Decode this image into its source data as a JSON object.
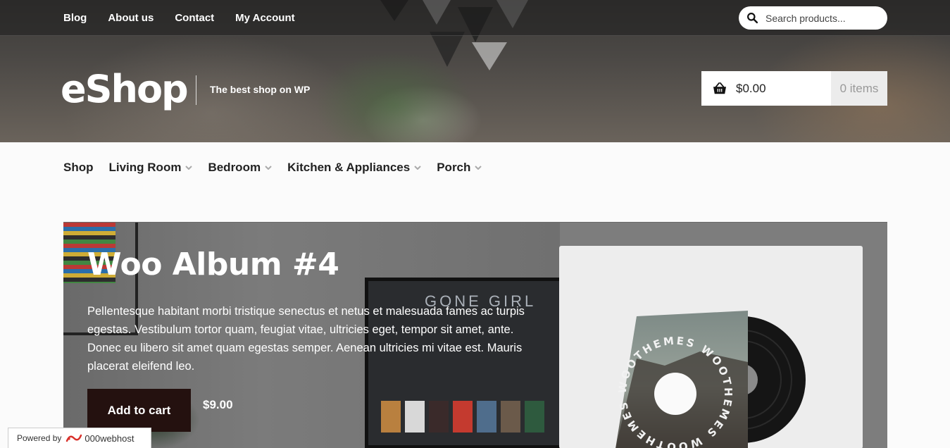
{
  "topbar": {
    "links": [
      "Blog",
      "About us",
      "Contact",
      "My Account"
    ],
    "search": {
      "placeholder": "Search products..."
    }
  },
  "brand": {
    "logo": "eShop",
    "tagline": "The best shop on WP"
  },
  "cart": {
    "amount": "$0.00",
    "items": "0 items"
  },
  "main_nav": [
    {
      "label": "Shop",
      "has_dropdown": false
    },
    {
      "label": "Living Room",
      "has_dropdown": true
    },
    {
      "label": "Bedroom",
      "has_dropdown": true
    },
    {
      "label": "Kitchen & Appliances",
      "has_dropdown": true
    },
    {
      "label": "Porch",
      "has_dropdown": true
    }
  ],
  "hero": {
    "title": "Woo Album #4",
    "description": "Pellentesque habitant morbi tristique senectus et netus et malesuada fames ac turpis egestas. Vestibulum tortor quam, feugiat vitae, ultricies eget, tempor sit amet, ante. Donec eu libero sit amet quam egestas semper. Aenean ultricies mi vitae est. Mauris placerat eleifend leo.",
    "button": "Add to cart",
    "price": "$9.00",
    "tv_title": "GONE GIRL",
    "album_text": "WOOTHEMES WOOTHEMES WOOTHEMES"
  },
  "badge": {
    "powered_by": "Powered by",
    "host": "000webhost"
  },
  "colors": {
    "button_bg": "#24110f",
    "cart_items_bg": "#ececec",
    "page_bg": "#fbfbfb"
  },
  "icons": [
    "search-icon",
    "basket-icon",
    "chevron-down-icon",
    "webhost-logo-icon"
  ]
}
